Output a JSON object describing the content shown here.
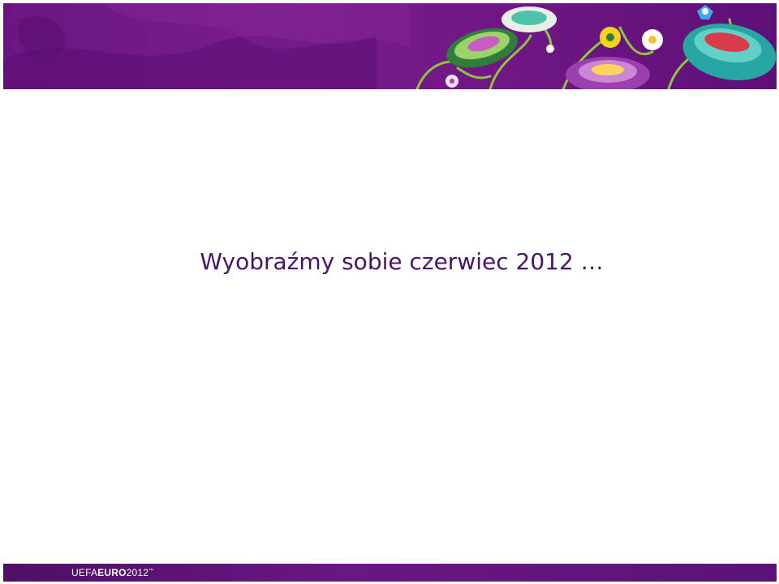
{
  "slide": {
    "title": "Wyobraźmy sobie czerwiec 2012 …"
  },
  "footer": {
    "logo_prefix": "UEFA",
    "logo_bold": "EURO",
    "logo_year": "2012",
    "logo_tm": "™"
  },
  "colors": {
    "banner_purple": "#6b1583",
    "title_text": "#4b1369",
    "footer_purple": "#5a1277"
  }
}
